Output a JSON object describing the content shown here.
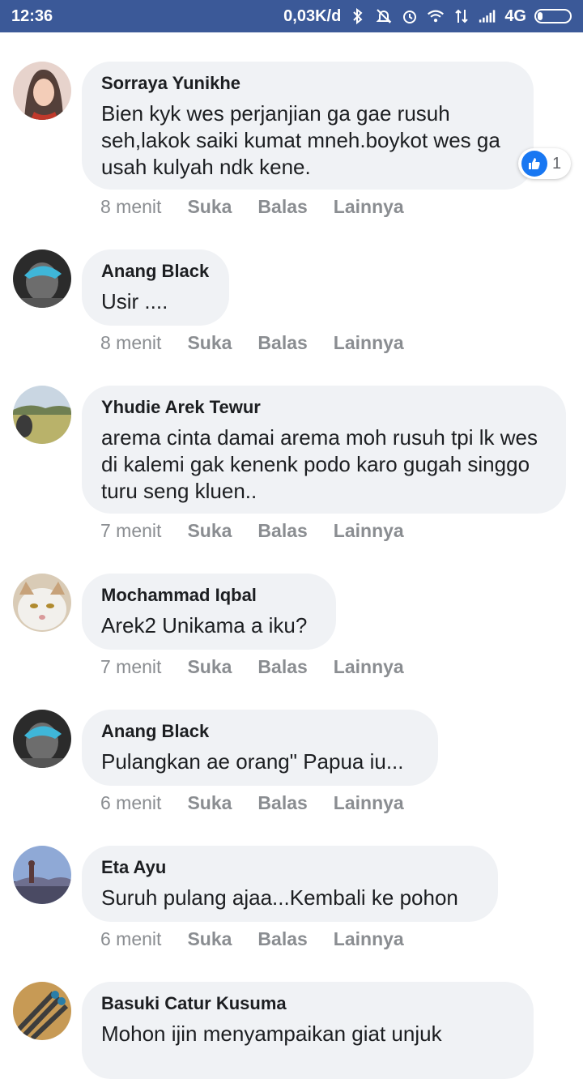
{
  "status_bar": {
    "time": "12:36",
    "speed": "0,03K/d",
    "network": "4G",
    "icons": [
      "bluetooth-icon",
      "mute-icon",
      "alarm-icon",
      "wifi-icon",
      "data-transfer-icon",
      "signal-icon",
      "battery-icon"
    ]
  },
  "actions": {
    "like": "Suka",
    "reply": "Balas",
    "more": "Lainnya"
  },
  "comments": [
    {
      "name": "Sorraya Yunikhe",
      "text": "Bien kyk wes perjanjian ga gae rusuh seh,lakok saiki kumat mneh.boykot wes ga usah kulyah ndk kene.",
      "time": "8 menit",
      "reaction_count": "1"
    },
    {
      "name": "Anang Black",
      "text": "Usir ....",
      "time": "8 menit"
    },
    {
      "name": "Yhudie Arek Tewur",
      "text": "arema cinta damai arema moh rusuh tpi lk wes di kalemi gak kenenk podo karo gugah singgo turu seng kluen..",
      "time": "7 menit"
    },
    {
      "name": "Mochammad Iqbal",
      "text": "Arek2 Unikama a iku?",
      "time": "7 menit"
    },
    {
      "name": "Anang Black",
      "text": "Pulangkan ae orang\" Papua iu...",
      "time": "6 menit"
    },
    {
      "name": "Eta Ayu",
      "text": "Suruh pulang ajaa...Kembali ke pohon",
      "time": "6 menit"
    },
    {
      "name": "Basuki Catur Kusuma",
      "text": "Mohon ijin menyampaikan giat unjuk",
      "time": ""
    }
  ],
  "colors": {
    "status_bar": "#3b5998",
    "bubble": "#f0f2f5",
    "meta": "#8a8d91",
    "like": "#1877f2"
  }
}
